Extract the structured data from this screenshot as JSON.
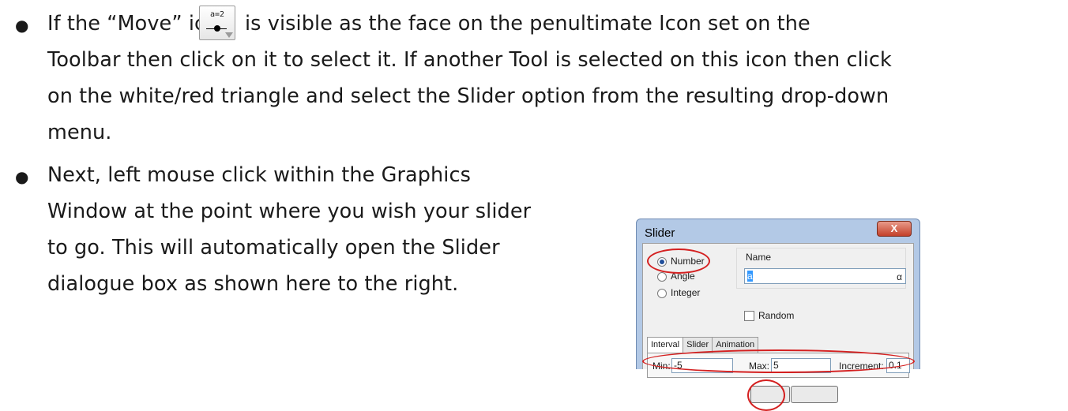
{
  "paragraphs": [
    {
      "lines": [
        {
          "before_icon": "If the “Move” icon",
          "after_icon": "is visible as the face on the penultimate Icon set on the"
        },
        "Toolbar then click on it to select it.  If another Tool is selected on this icon then click",
        "on the white/red triangle and select the Slider option from the resulting drop-down",
        "menu."
      ]
    },
    {
      "lines": [
        "Next, left mouse click within the Graphics",
        "Window at the point where you wish your slider",
        "to go.  This will automatically open the Slider",
        "dialogue box as shown here to the right."
      ]
    }
  ],
  "inline_icon": {
    "text": "a=2",
    "icon": "slider-tool-icon"
  },
  "dialog": {
    "title": "Slider",
    "close_label": "X",
    "radios": [
      {
        "label": "Number",
        "checked": true
      },
      {
        "label": "Angle",
        "checked": false
      },
      {
        "label": "Integer",
        "checked": false
      }
    ],
    "name_label": "Name",
    "name_value": "a",
    "alpha_label": "α",
    "random_label": "Random",
    "tabs": [
      "Interval",
      "Slider",
      "Animation"
    ],
    "active_tab": "Interval",
    "min_label": "Min:",
    "min_value": "-5",
    "max_label": "Max:",
    "max_value": "5",
    "increment_label": "Increment:",
    "increment_value": "0.1"
  },
  "colors": {
    "highlight": "#d42020",
    "dialog_frame": "#b3c9e6",
    "close_button": "#c4412a"
  }
}
